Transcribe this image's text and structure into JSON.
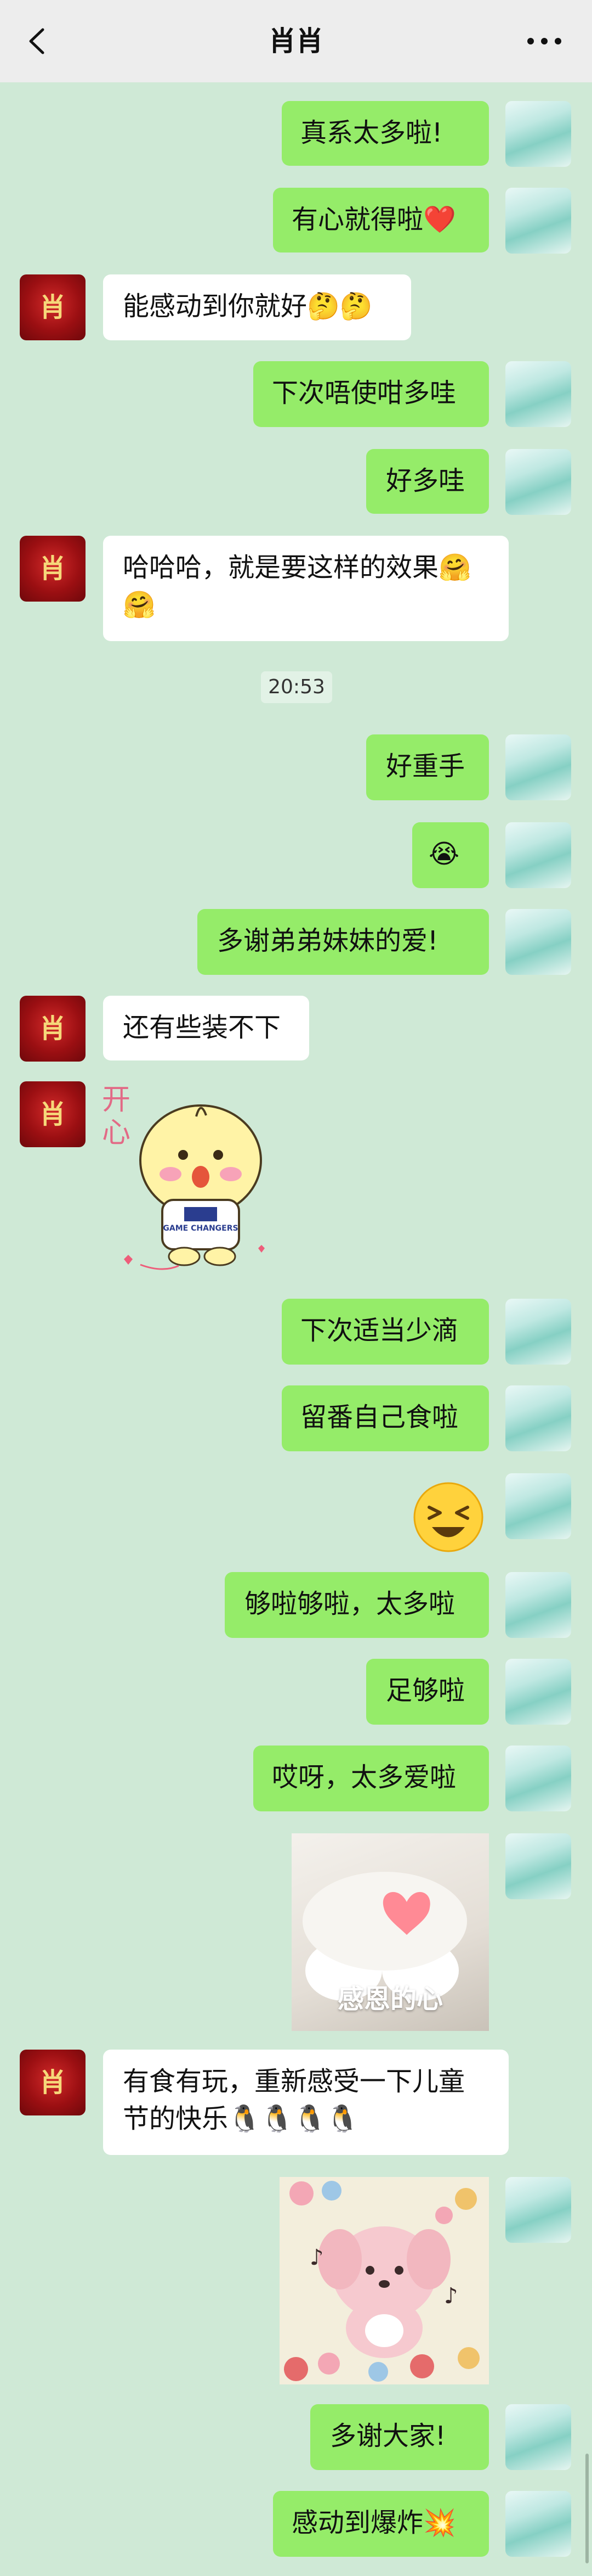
{
  "header": {
    "title": "肖肖",
    "back_icon": "chevron-left-icon",
    "more_icon": "more-dots-icon"
  },
  "messages": [
    {
      "dir": "out",
      "text": "真系太多啦!"
    },
    {
      "dir": "out",
      "text": "有心就得啦❤️"
    },
    {
      "dir": "in",
      "text": "能感动到你就好🤔🤔"
    },
    {
      "dir": "out",
      "text": "下次唔使咁多哇"
    },
    {
      "dir": "out",
      "text": "好多哇"
    },
    {
      "dir": "in",
      "text": "哈哈哈，就是要这样的效果🤗\n🤗"
    },
    {
      "dir": "time",
      "text": "20:53"
    },
    {
      "dir": "out",
      "text": "好重手"
    },
    {
      "dir": "out",
      "text": "😭"
    },
    {
      "dir": "out",
      "text": "多谢弟弟妹妹的爱!"
    },
    {
      "dir": "in",
      "text": "还有些装不下"
    },
    {
      "dir": "in",
      "type": "sticker",
      "text": "开心",
      "shirt_text": "GAME CHANGERS"
    },
    {
      "dir": "out",
      "text": "下次适当少滴"
    },
    {
      "dir": "out",
      "text": "留番自己食啦"
    },
    {
      "dir": "out",
      "type": "emoji",
      "text": "😆"
    },
    {
      "dir": "out",
      "text": "够啦够啦，太多啦"
    },
    {
      "dir": "out",
      "text": "足够啦"
    },
    {
      "dir": "out",
      "text": "哎呀，太多爱啦"
    },
    {
      "dir": "out",
      "type": "image",
      "caption": "感恩的心"
    },
    {
      "dir": "in",
      "text": "有食有玩，重新感受一下儿童\n节的快乐🐧🐧🐧🐧"
    },
    {
      "dir": "out",
      "type": "image",
      "caption": ""
    },
    {
      "dir": "out",
      "text": "多谢大家!"
    },
    {
      "dir": "out",
      "text": "感动到爆炸💥"
    }
  ],
  "avatars": {
    "left_glyph": "肖"
  },
  "colors": {
    "background": "#cfe9d6",
    "out_bubble": "#95ec69",
    "in_bubble": "#ffffff",
    "header": "#ededed"
  }
}
